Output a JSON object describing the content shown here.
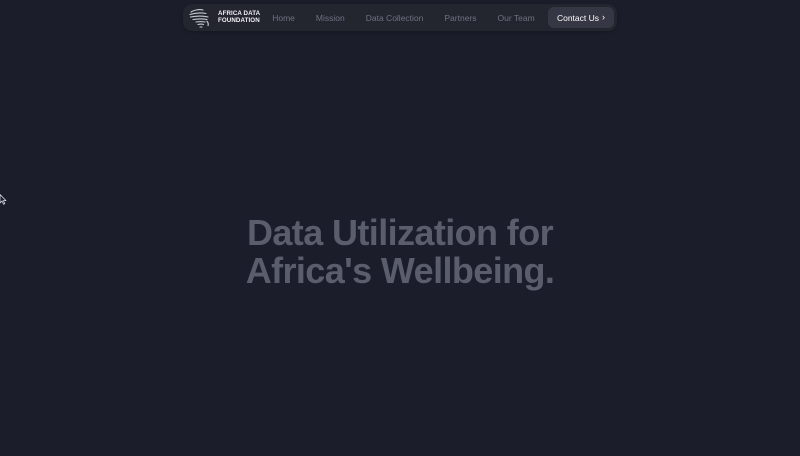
{
  "brand": {
    "line1": "AFRICA DATA",
    "line2": "FOUNDATION",
    "logo_icon": "africa-globe-icon"
  },
  "nav": {
    "items": [
      {
        "label": "Home"
      },
      {
        "label": "Mission"
      },
      {
        "label": "Data Collection"
      },
      {
        "label": "Partners"
      },
      {
        "label": "Our Team"
      }
    ],
    "contact": {
      "label": "Contact Us",
      "icon": "chevron-right-icon"
    }
  },
  "hero": {
    "line1": "Data Utilization for",
    "line2": "Africa's Wellbeing."
  },
  "colors": {
    "background": "#1b1d2a",
    "navbar": "#23252f",
    "nav_text": "#6f7282",
    "button": "#353744",
    "hero_text": "#5a5d6c"
  }
}
